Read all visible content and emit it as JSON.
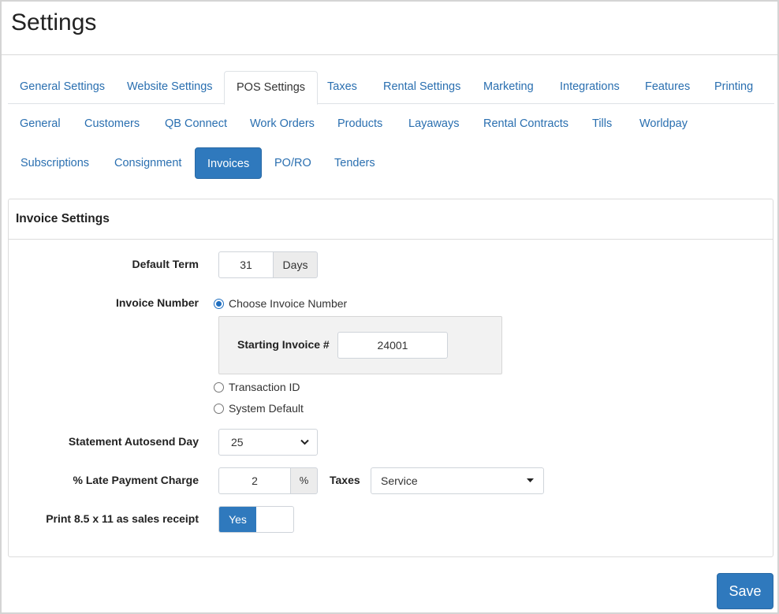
{
  "page": {
    "title": "Settings"
  },
  "tabs_main": [
    {
      "label": "General Settings",
      "active": false
    },
    {
      "label": "Website Settings",
      "active": false
    },
    {
      "label": "POS Settings",
      "active": true
    },
    {
      "label": "Taxes",
      "active": false
    },
    {
      "label": "Rental Settings",
      "active": false
    },
    {
      "label": "Marketing",
      "active": false
    },
    {
      "label": "Integrations",
      "active": false
    },
    {
      "label": "Features",
      "active": false
    },
    {
      "label": "Printing",
      "active": false
    }
  ],
  "subtabs": [
    {
      "label": "General",
      "active": false
    },
    {
      "label": "Customers",
      "active": false
    },
    {
      "label": "QB Connect",
      "active": false
    },
    {
      "label": "Work Orders",
      "active": false
    },
    {
      "label": "Products",
      "active": false
    },
    {
      "label": "Layaways",
      "active": false
    },
    {
      "label": "Rental Contracts",
      "active": false
    },
    {
      "label": "Tills",
      "active": false
    },
    {
      "label": "Worldpay",
      "active": false
    },
    {
      "label": "Subscriptions",
      "active": false
    },
    {
      "label": "Consignment",
      "active": false
    },
    {
      "label": "Invoices",
      "active": true
    },
    {
      "label": "PO/RO",
      "active": false
    },
    {
      "label": "Tenders",
      "active": false
    }
  ],
  "panel": {
    "title": "Invoice Settings",
    "default_term": {
      "label": "Default Term",
      "value": "31",
      "unit": "Days"
    },
    "invoice_number": {
      "label": "Invoice Number",
      "options": [
        {
          "label": "Choose Invoice Number",
          "checked": true
        },
        {
          "label": "Transaction ID",
          "checked": false
        },
        {
          "label": "System Default",
          "checked": false
        }
      ],
      "starting_label": "Starting Invoice #",
      "starting_value": "24001"
    },
    "statement_autosend": {
      "label": "Statement Autosend Day",
      "value": "25"
    },
    "late_payment": {
      "label": "% Late Payment Charge",
      "value": "2",
      "unit": "%",
      "taxes_label": "Taxes",
      "taxes_value": "Service"
    },
    "print_receipt": {
      "label": "Print 8.5 x 11 as sales receipt",
      "toggle_label": "Yes",
      "on": true
    }
  },
  "actions": {
    "save_label": "Save"
  },
  "colors": {
    "accent": "#2f79bd",
    "link": "#2a6fb0"
  },
  "icons": {
    "select_caret": "chevron-down-icon",
    "taxes_caret": "caret-down-icon"
  }
}
